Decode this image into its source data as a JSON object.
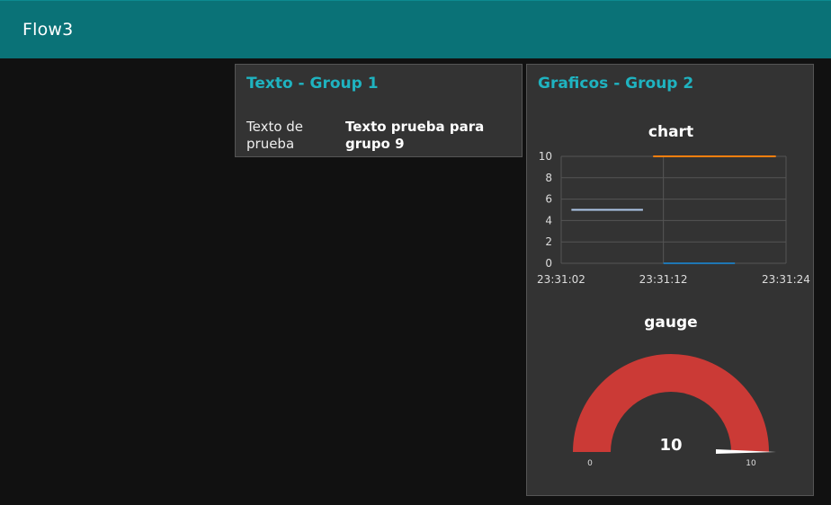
{
  "toolbar": {
    "title": "Flow3"
  },
  "groups": {
    "group1": {
      "title": "Texto - Group 1",
      "text_label": "Texto de prueba",
      "text_value": "Texto prueba para grupo 9"
    },
    "group2": {
      "title": "Graficos - Group 2"
    }
  },
  "chart": {
    "title": "chart",
    "y_ticks": [
      "0",
      "2",
      "4",
      "6",
      "8",
      "10"
    ],
    "x_ticks": [
      "23:31:02",
      "23:31:12",
      "23:31:24"
    ]
  },
  "chart_data": {
    "type": "line",
    "title": "chart",
    "xlabel": "",
    "ylabel": "",
    "ylim": [
      0,
      10
    ],
    "grid": true,
    "x_ticks": [
      "23:31:02",
      "23:31:12",
      "23:31:24"
    ],
    "series": [
      {
        "color": "#aec7e8",
        "points": [
          [
            "23:31:03",
            5
          ],
          [
            "23:31:10",
            5
          ]
        ]
      },
      {
        "color": "#1f77b4",
        "points": [
          [
            "23:31:12",
            0
          ],
          [
            "23:31:19",
            0
          ]
        ]
      },
      {
        "color": "#ff7f0e",
        "points": [
          [
            "23:31:11",
            10
          ],
          [
            "23:31:23",
            10
          ]
        ]
      }
    ]
  },
  "gauge": {
    "title": "gauge",
    "value": "10",
    "min": "0",
    "max": "10",
    "color": "#cb3a36"
  }
}
